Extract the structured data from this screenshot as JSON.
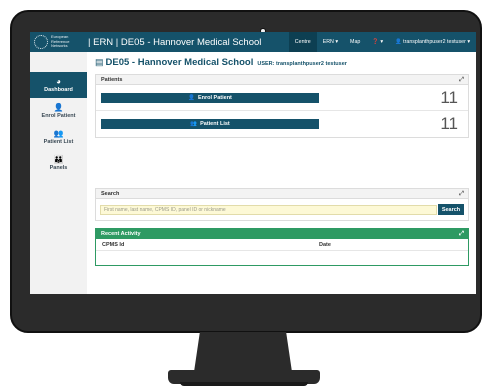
{
  "logo": {
    "line1": "European",
    "line2": "Reference",
    "line3": "Networks"
  },
  "navbar": {
    "title": "| ERN | DE05 - Hannover Medical School",
    "items": [
      {
        "label": "Centre",
        "active": true
      },
      {
        "label": "ERN ▾"
      },
      {
        "label": "Map"
      },
      {
        "label": "❓ ▾"
      },
      {
        "label": "👤 transplanthpuser2 testuser ▾"
      }
    ]
  },
  "sidebar": {
    "items": [
      {
        "label": "Dashboard",
        "icon": "dashboard-icon",
        "active": true
      },
      {
        "label": "Enrol Patient",
        "icon": "user-plus-icon"
      },
      {
        "label": "Patient List",
        "icon": "users-icon"
      },
      {
        "label": "Panels",
        "icon": "group-icon"
      }
    ]
  },
  "page": {
    "title": "DE05 - Hannover Medical School",
    "user_label": "USER: transplanthpuser2 testuser"
  },
  "patients_panel": {
    "heading": "Patients",
    "enrol_label": "Enrol Patient",
    "enrol_count": "11",
    "list_label": "Patient List",
    "list_count": "11"
  },
  "search_panel": {
    "heading": "Search",
    "placeholder": "First name, last name, CPMS ID, panel ID or nickname",
    "button_label": "Search"
  },
  "activity_panel": {
    "heading": "Recent Activity",
    "columns": [
      "CPMS Id",
      "Date"
    ]
  },
  "colors": {
    "primary": "#15526a",
    "success": "#2e9a63",
    "search_bg": "#fdf9d6"
  }
}
